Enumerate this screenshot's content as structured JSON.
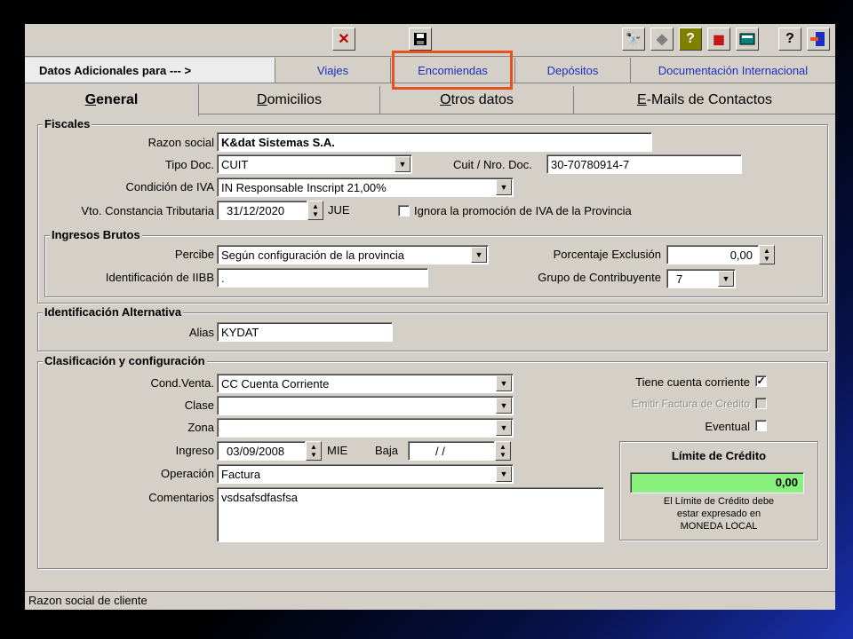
{
  "toolbar": {
    "icons": [
      "close-icon",
      "save-icon",
      "binoculars-icon",
      "back-icon",
      "help-icon",
      "grid-icon",
      "calculator-icon",
      "question-icon",
      "exit-icon"
    ]
  },
  "top_tabs": {
    "header": "Datos Adicionales para --- >",
    "items": [
      "Viajes",
      "Encomiendas",
      "Depósitos",
      "Documentación Internacional"
    ]
  },
  "inner_tabs": {
    "general": {
      "hot": "G",
      "rest": "eneral"
    },
    "domicilios": {
      "hot": "D",
      "rest": "omicilios"
    },
    "otros": {
      "hot": "O",
      "rest": "tros datos"
    },
    "emails": {
      "hot": "E",
      "rest": "-Mails de Contactos"
    }
  },
  "fiscales": {
    "title": "Fiscales",
    "razon_social_label": "Razon social",
    "razon_social": "K&dat Sistemas S.A.",
    "tipo_doc_label": "Tipo Doc.",
    "tipo_doc": "CUIT",
    "cuit_label": "Cuit / Nro. Doc.",
    "cuit": "30-70780914-7",
    "iva_label": "Condición de IVA",
    "iva": "IN Responsable Inscript 21,00%",
    "vto_label": "Vto. Constancia Tributaria",
    "vto": "31/12/2020",
    "vto_day": "JUE",
    "ignora_label": "Ignora la promoción de IVA de la Provincia"
  },
  "ingresos": {
    "title": "Ingresos Brutos",
    "percibe_label": "Percibe",
    "percibe": "Según configuración de la provincia",
    "porcentaje_label": "Porcentaje Exclusión",
    "porcentaje": "0,00",
    "iibb_label": "Identificación de IIBB",
    "iibb": ".",
    "grupo_label": "Grupo de Contribuyente",
    "grupo": "7"
  },
  "alternativa": {
    "title": "Identificación Alternativa",
    "alias_label": "Alias",
    "alias": "KYDAT"
  },
  "clasificacion": {
    "title": "Clasificación y configuración",
    "cond_venta_label": "Cond.Venta.",
    "cond_venta": "CC Cuenta Corriente",
    "clase_label": "Clase",
    "clase": "",
    "zona_label": "Zona",
    "zona": "",
    "ingreso_label": "Ingreso",
    "ingreso": "03/09/2008",
    "ingreso_day": "MIE",
    "baja_label": "Baja",
    "baja": "/ /",
    "operacion_label": "Operación",
    "operacion": "Factura",
    "comentarios_label": "Comentarios",
    "comentarios": "vsdsafsdfasfsa",
    "cuenta_corriente_label": "Tiene cuenta corriente",
    "emitir_label": "Emitir Factura de Crédito",
    "eventual_label": "Eventual"
  },
  "limite": {
    "title": "Límite de Crédito",
    "value": "0,00",
    "note1": "El Límite de Crédito debe",
    "note2": "estar expresado en",
    "note3": "MONEDA LOCAL"
  },
  "status": "Razon social de cliente",
  "colors": {
    "highlight": "#e8501d",
    "limite_bg": "#88f07c",
    "link": "#1a2fbf"
  }
}
